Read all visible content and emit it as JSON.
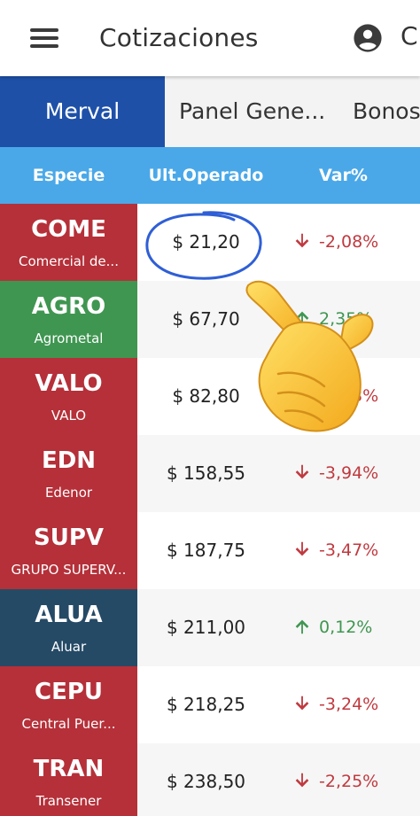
{
  "appbar": {
    "title": "Cotizaciones",
    "overflow_text": "C",
    "menu_icon": "menu-icon",
    "account_icon": "account-circle-icon"
  },
  "tabs": [
    {
      "label": "Merval",
      "active": true
    },
    {
      "label": "Panel Gene...",
      "active": false
    },
    {
      "label": "Bonos",
      "active": false
    }
  ],
  "table": {
    "headers": [
      "Especie",
      "Ult.Operado",
      "Var%"
    ],
    "rows": [
      {
        "symbol": "COME",
        "name": "Comercial de...",
        "price": "$ 21,20",
        "change": "-2,08%",
        "direction": "down",
        "color": "#b53039"
      },
      {
        "symbol": "AGRO",
        "name": "Agrometal",
        "price": "$ 67,70",
        "change": "2,35%",
        "direction": "up",
        "color": "#3f9651"
      },
      {
        "symbol": "VALO",
        "name": "VALO",
        "price": "$ 82,80",
        "change": "-0,13%",
        "direction": "down",
        "color": "#b53039"
      },
      {
        "symbol": "EDN",
        "name": "Edenor",
        "price": "$ 158,55",
        "change": "-3,94%",
        "direction": "down",
        "color": "#b53039"
      },
      {
        "symbol": "SUPV",
        "name": "GRUPO SUPERV...",
        "price": "$ 187,75",
        "change": "-3,47%",
        "direction": "down",
        "color": "#b53039"
      },
      {
        "symbol": "ALUA",
        "name": "Aluar",
        "price": "$ 211,00",
        "change": "0,12%",
        "direction": "up",
        "color": "#254a66"
      },
      {
        "symbol": "CEPU",
        "name": "Central Puer...",
        "price": "$ 218,25",
        "change": "-3,24%",
        "direction": "down",
        "color": "#b53039"
      },
      {
        "symbol": "TRAN",
        "name": "Transener",
        "price": "$ 238,50",
        "change": "-2,25%",
        "direction": "down",
        "color": "#b53039"
      }
    ]
  },
  "colors": {
    "tab_active": "#1e50a8",
    "header_bg": "#4aa8e8",
    "down": "#c0393f",
    "up": "#3f9651",
    "annotation": "#2f5fd6"
  },
  "annotations": {
    "circle": "hand-drawn-circle-around-price",
    "pointer": "pointing-hand-emoji"
  }
}
